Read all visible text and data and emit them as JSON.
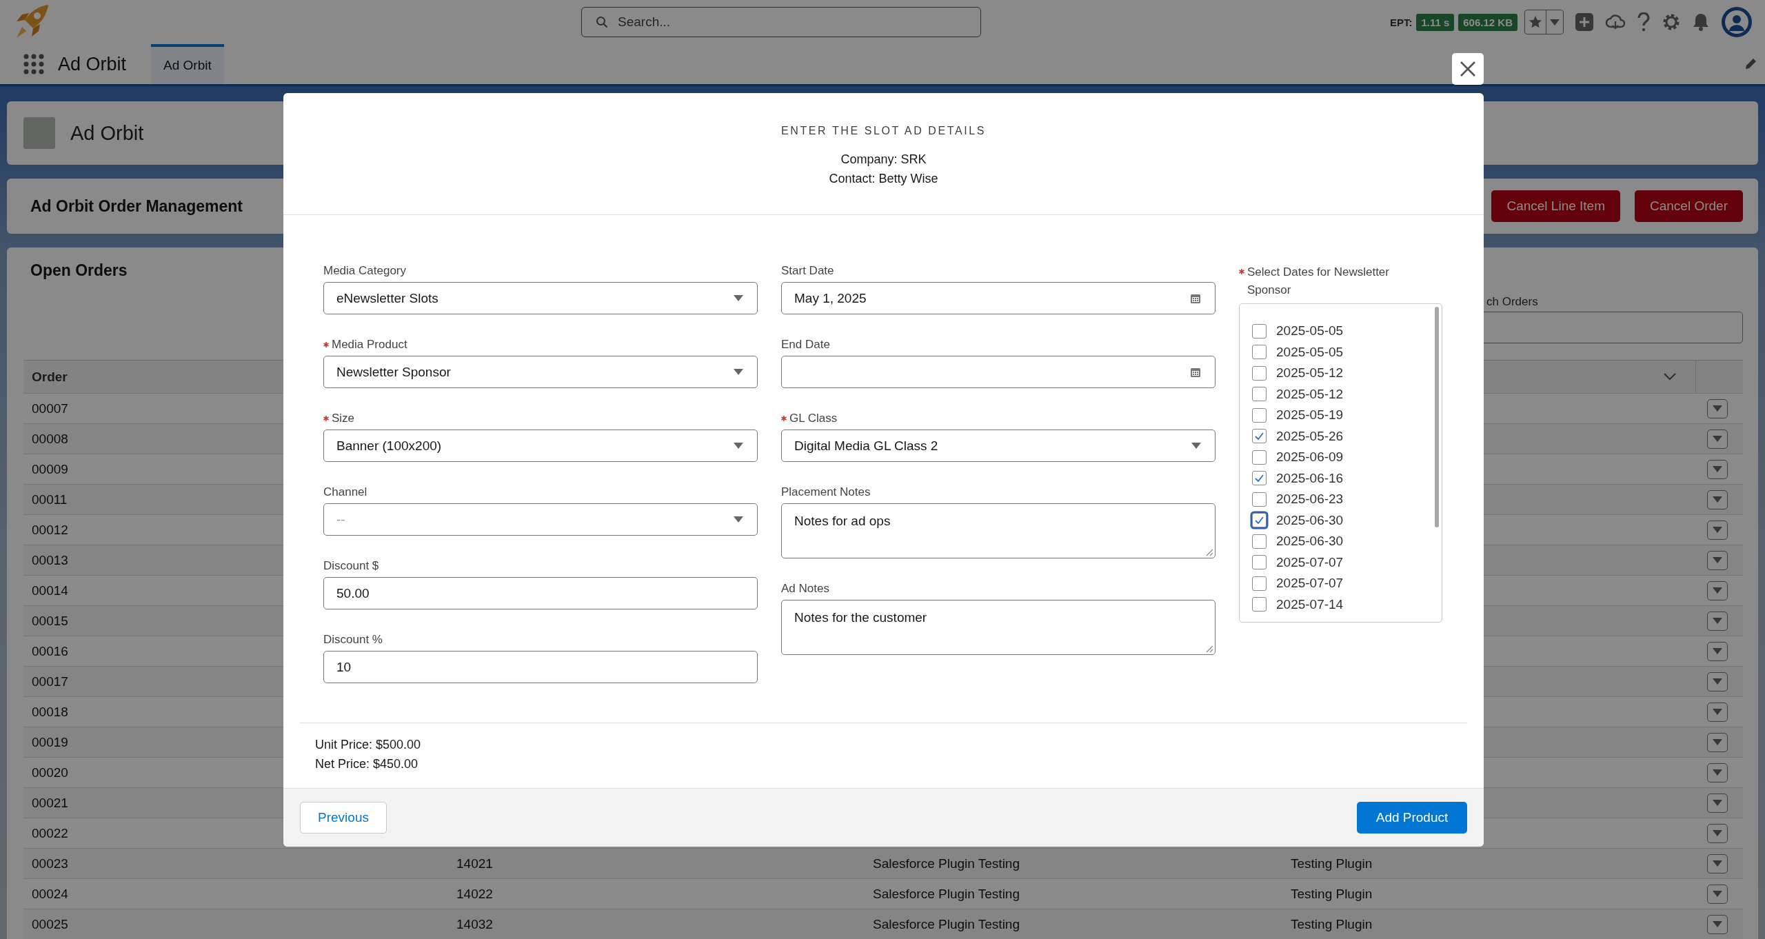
{
  "header": {
    "search": {
      "placeholder": "Search..."
    },
    "ept": {
      "label": "EPT:",
      "time": "1.11 s",
      "size": "606.12 KB"
    }
  },
  "nav": {
    "app_name": "Ad Orbit",
    "tabs": [
      {
        "label": "Ad Orbit",
        "selected": true
      }
    ]
  },
  "page_header": {
    "title": "Ad Orbit"
  },
  "order_management": {
    "title": "Ad Orbit Order Management",
    "buttons": [
      "Cancel Line Item",
      "Cancel Order"
    ]
  },
  "open_orders": {
    "title": "Open Orders",
    "search_label": "ch Orders",
    "table": {
      "columns": [
        "Order"
      ],
      "rows": [
        {
          "cells": [
            "00007"
          ]
        },
        {
          "cells": [
            "00008"
          ]
        },
        {
          "cells": [
            "00009"
          ]
        },
        {
          "cells": [
            "00011"
          ]
        },
        {
          "cells": [
            "00012"
          ]
        },
        {
          "cells": [
            "00013"
          ]
        },
        {
          "cells": [
            "00014"
          ]
        },
        {
          "cells": [
            "00015"
          ]
        },
        {
          "cells": [
            "00016"
          ]
        },
        {
          "cells": [
            "00017"
          ]
        },
        {
          "cells": [
            "00018"
          ]
        },
        {
          "cells": [
            "00019"
          ]
        },
        {
          "cells": [
            "00020"
          ]
        },
        {
          "cells": [
            "00021"
          ]
        },
        {
          "cells": [
            "00022"
          ]
        },
        {
          "cells": [
            "00023",
            "14021",
            "Salesforce Plugin Testing",
            "Testing Plugin"
          ]
        },
        {
          "cells": [
            "00024",
            "14022",
            "Salesforce Plugin Testing",
            "Testing Plugin"
          ]
        },
        {
          "cells": [
            "00025",
            "14032",
            "Salesforce Plugin Testing",
            "Testing Plugin"
          ]
        }
      ]
    }
  },
  "modal": {
    "title": "ENTER THE SLOT AD DETAILS",
    "company": "Company: SRK",
    "contact": "Contact: Betty Wise",
    "left_fields": [
      {
        "kind": "select",
        "label": "Media Category",
        "required": false,
        "value": "eNewsletter Slots"
      },
      {
        "kind": "select",
        "label": "Media Product",
        "required": true,
        "value": "Newsletter Sponsor"
      },
      {
        "kind": "select",
        "label": "Size",
        "required": true,
        "value": "Banner (100x200)"
      },
      {
        "kind": "select",
        "label": "Channel",
        "required": false,
        "placeholder": "--"
      },
      {
        "kind": "text",
        "label": "Discount $",
        "required": false,
        "value": "50.00"
      },
      {
        "kind": "text",
        "label": "Discount %",
        "required": false,
        "value": "10"
      }
    ],
    "middle_fields": [
      {
        "kind": "date",
        "label": "Start Date",
        "required": false,
        "value": "May 1, 2025"
      },
      {
        "kind": "date",
        "label": "End Date",
        "required": false
      },
      {
        "kind": "select",
        "label": "GL Class",
        "required": true,
        "value": "Digital Media GL Class 2"
      },
      {
        "kind": "textarea",
        "label": "Placement Notes",
        "required": false,
        "value": "Notes for ad ops"
      },
      {
        "kind": "textarea",
        "label": "Ad Notes",
        "required": false,
        "value": "Notes for the customer"
      }
    ],
    "date_picker": {
      "label": "Select Dates for Newsletter Sponsor",
      "required": true,
      "dates": [
        {
          "label": "2025-05-05",
          "checked": false,
          "focused": false
        },
        {
          "label": "2025-05-05",
          "checked": false,
          "focused": false
        },
        {
          "label": "2025-05-12",
          "checked": false,
          "focused": false
        },
        {
          "label": "2025-05-12",
          "checked": false,
          "focused": false
        },
        {
          "label": "2025-05-19",
          "checked": false,
          "focused": false
        },
        {
          "label": "2025-05-26",
          "checked": true,
          "focused": false
        },
        {
          "label": "2025-06-09",
          "checked": false,
          "focused": false
        },
        {
          "label": "2025-06-16",
          "checked": true,
          "focused": false
        },
        {
          "label": "2025-06-23",
          "checked": false,
          "focused": false
        },
        {
          "label": "2025-06-30",
          "checked": true,
          "focused": true
        },
        {
          "label": "2025-06-30",
          "checked": false,
          "focused": false
        },
        {
          "label": "2025-07-07",
          "checked": false,
          "focused": false
        },
        {
          "label": "2025-07-07",
          "checked": false,
          "focused": false
        },
        {
          "label": "2025-07-14",
          "checked": false,
          "focused": false
        }
      ]
    },
    "unit_price": "Unit Price: $500.00",
    "net_price": "Net Price: $450.00",
    "previous_button": "Previous",
    "add_button": "Add Product"
  }
}
